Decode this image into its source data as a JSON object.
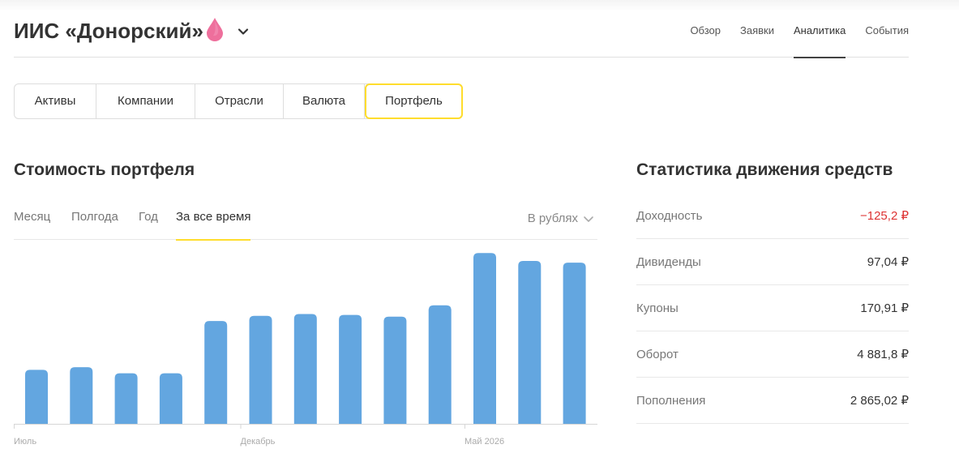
{
  "account": {
    "title": "ИИС «Донорский»"
  },
  "nav": [
    {
      "label": "Обзор",
      "active": false
    },
    {
      "label": "Заявки",
      "active": false
    },
    {
      "label": "Аналитика",
      "active": true
    },
    {
      "label": "События",
      "active": false
    }
  ],
  "segments": [
    {
      "label": "Активы",
      "active": false
    },
    {
      "label": "Компании",
      "active": false
    },
    {
      "label": "Отрасли",
      "active": false
    },
    {
      "label": "Валюта",
      "active": false
    },
    {
      "label": "Портфель",
      "active": true
    }
  ],
  "portfolio": {
    "title": "Стоимость портфеля",
    "periods": [
      {
        "label": "Месяц",
        "active": false
      },
      {
        "label": "Полгода",
        "active": false
      },
      {
        "label": "Год",
        "active": false
      },
      {
        "label": "За все время",
        "active": true
      }
    ],
    "currency_label": "В рублях"
  },
  "stats": {
    "title": "Статистика движения средств",
    "rows": [
      {
        "label": "Доходность",
        "value": "−125,2 ₽",
        "negative": true
      },
      {
        "label": "Дивиденды",
        "value": "97,04 ₽",
        "negative": false
      },
      {
        "label": "Купоны",
        "value": "170,91 ₽",
        "negative": false
      },
      {
        "label": "Оборот",
        "value": "4 881,8 ₽",
        "negative": false
      },
      {
        "label": "Пополнения",
        "value": "2 865,02 ₽",
        "negative": false
      }
    ]
  },
  "colors": {
    "accent": "#ffdd2d",
    "bar": "#63a6e0",
    "negative": "#dd3333",
    "drop": "#ee6f9c"
  },
  "chart_data": {
    "type": "bar",
    "tick_labels": [
      {
        "label": "Июль",
        "index": 0
      },
      {
        "label": "Декабрь",
        "index": 5
      },
      {
        "label": "Май 2026",
        "index": 10
      }
    ],
    "values": [
      62,
      65,
      58,
      58,
      118,
      124,
      126,
      125,
      123,
      136,
      196,
      187,
      185
    ],
    "ylim": [
      0,
      200
    ],
    "grid": false,
    "legend": "none"
  }
}
